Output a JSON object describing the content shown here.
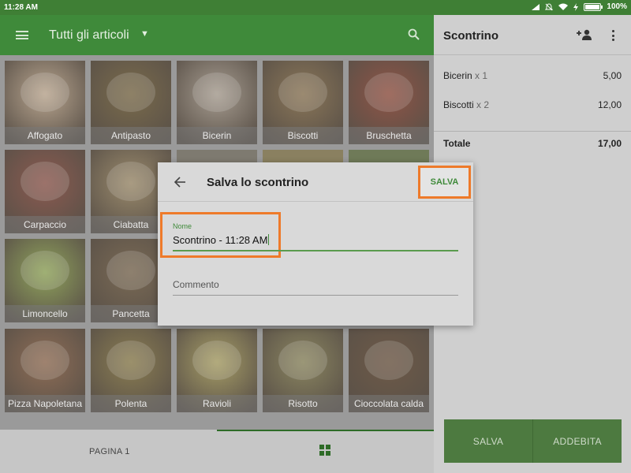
{
  "status_bar": {
    "time": "11:28 AM",
    "battery": "100%",
    "battery_level": 1.0
  },
  "app_bar": {
    "title": "Tutti gli articoli",
    "menu_icon": "hamburger-menu-icon",
    "dropdown_icon": "chevron-down-icon",
    "search_icon": "search-icon"
  },
  "items": [
    {
      "label": "Affogato",
      "color": "#b8a58f"
    },
    {
      "label": "Antipasto",
      "color": "#7a6b4c"
    },
    {
      "label": "Bicerin",
      "color": "#a69c90"
    },
    {
      "label": "Biscotti",
      "color": "#8a7658"
    },
    {
      "label": "Bruschetta",
      "color": "#8f5446"
    },
    {
      "label": "Carpaccio",
      "color": "#8b5a50"
    },
    {
      "label": "Ciabatta",
      "color": "#9a8a6c"
    },
    {
      "label": "Limoncello",
      "color": "#8fa25c"
    },
    {
      "label": "Pancetta",
      "color": "#7a6a55"
    },
    {
      "label": "Pizza Napoletana",
      "color": "#8e6d56"
    },
    {
      "label": "Polenta",
      "color": "#8a7d52"
    },
    {
      "label": "Ravioli",
      "color": "#a59c66"
    },
    {
      "label": "Risotto",
      "color": "#8a8560"
    },
    {
      "label": "Cioccolata calda",
      "color": "#6e5a48"
    }
  ],
  "bottom_nav": {
    "page_label": "PAGINA 1",
    "grid_icon": "grid-view-icon"
  },
  "receipt": {
    "title": "Scontrino",
    "add_customer_icon": "add-person-icon",
    "more_icon": "more-vert-icon",
    "lines": [
      {
        "name": "Bicerin",
        "qty": "x 1",
        "price": "5,00"
      },
      {
        "name": "Biscotti",
        "qty": "x 2",
        "price": "12,00"
      }
    ],
    "total_label": "Totale",
    "total_value": "17,00",
    "save_button": "SALVA",
    "charge_button": "ADDEBITA"
  },
  "dialog": {
    "title": "Salva lo scontrino",
    "back_icon": "arrow-back-icon",
    "save_label": "SALVA",
    "name_label": "Nome",
    "name_value": "Scontrino - 11:28 AM",
    "comment_placeholder": "Commento"
  },
  "colors": {
    "primary": "#3f8a3a",
    "highlight": "#ee7a2a"
  }
}
